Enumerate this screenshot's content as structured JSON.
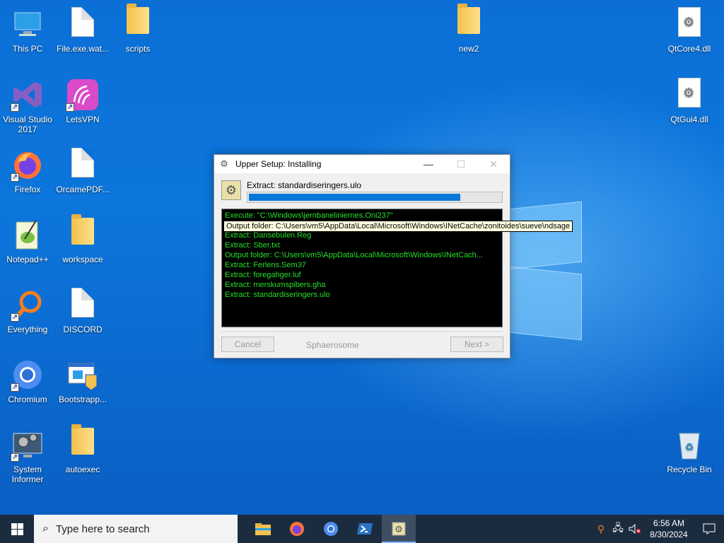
{
  "desktop": {
    "icons": [
      {
        "label": "This PC",
        "icon": "computer-icon"
      },
      {
        "label": "File.exe.wat...",
        "icon": "file-icon"
      },
      {
        "label": "scripts",
        "icon": "folder-icon"
      },
      {
        "label": "new2",
        "icon": "folder-icon"
      },
      {
        "label": "QtCore4.dll",
        "icon": "dll-icon"
      },
      {
        "label": "Visual Studio 2017",
        "icon": "visual-studio-icon"
      },
      {
        "label": "LetsVPN",
        "icon": "letsvpn-icon"
      },
      {
        "label": "QtGui4.dll",
        "icon": "dll-icon"
      },
      {
        "label": "Firefox",
        "icon": "firefox-icon"
      },
      {
        "label": "OrcamePDF...",
        "icon": "file-icon"
      },
      {
        "label": "Notepad++",
        "icon": "notepadpp-icon"
      },
      {
        "label": "workspace",
        "icon": "folder-icon"
      },
      {
        "label": "Everything",
        "icon": "everything-search-icon"
      },
      {
        "label": "DISCORD",
        "icon": "file-icon"
      },
      {
        "label": "Chromium",
        "icon": "chromium-icon"
      },
      {
        "label": "Bootstrapp...",
        "icon": "installer-icon"
      },
      {
        "label": "System Informer",
        "icon": "system-informer-icon"
      },
      {
        "label": "autoexec",
        "icon": "folder-icon"
      },
      {
        "label": "Recycle Bin",
        "icon": "recycle-bin-icon"
      }
    ]
  },
  "setup_window": {
    "title": "Upper Setup: Installing",
    "status": "Extract: standardiseringers.ulo",
    "progress_fraction": 0.84,
    "log": [
      "Execute: \"C:\\Windows\\jernbaneliniernes.Oni237\"",
      "Output folder: C:\\Users\\vm5\\AppData\\Local\\Microsoft\\Windows\\INetCache\\zonitoides\\sueve\\ndsage",
      "Extract: Dansebulen.Reg",
      "Extract: Sber.txt",
      "Output folder: C:\\Users\\vm5\\AppData\\Local\\Microsoft\\Windows\\INetCach...",
      "Extract: Ferlens.Sem37",
      "Extract: foregahger.luf",
      "Extract: merskumspibers.gha",
      "Extract: standardiseringers.ulo"
    ],
    "tooltip": "Output folder: C:\\Users\\vm5\\AppData\\Local\\Microsoft\\Windows\\INetCache\\zonitoides\\sueve\\ndsage",
    "cancel_label": "Cancel",
    "brand_label": "Sphaerosome",
    "next_label": "Next >"
  },
  "taskbar": {
    "search_placeholder": "Type here to search",
    "apps": [
      "file-explorer-icon",
      "firefox-icon",
      "chromium-icon",
      "powershell-icon",
      "setup-icon"
    ],
    "time": "6:56 AM",
    "date": "8/30/2024"
  }
}
